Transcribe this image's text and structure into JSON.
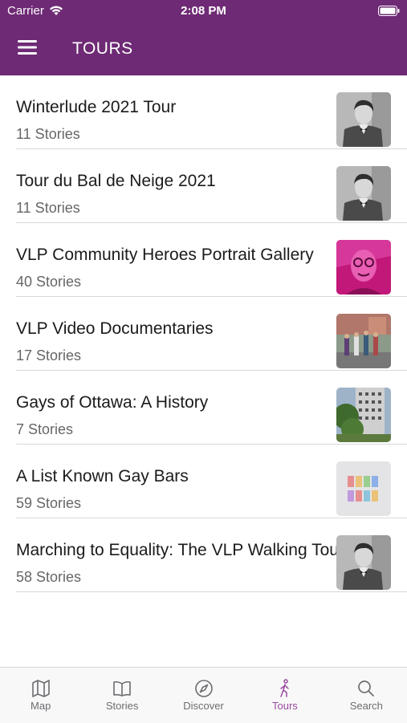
{
  "status_bar": {
    "carrier": "Carrier",
    "time": "2:08 PM"
  },
  "header": {
    "title": "TOURS"
  },
  "tours": [
    {
      "title": "Winterlude 2021 Tour",
      "subtitle": "11 Stories",
      "thumb": "portrait-bw"
    },
    {
      "title": "Tour du Bal de Neige 2021",
      "subtitle": "11 Stories",
      "thumb": "portrait-bw"
    },
    {
      "title": "VLP Community Heroes Portrait Gallery",
      "subtitle": "40 Stories",
      "thumb": "portrait-magenta"
    },
    {
      "title": "VLP Video Documentaries",
      "subtitle": "17 Stories",
      "thumb": "street-people"
    },
    {
      "title": "Gays of Ottawa: A History",
      "subtitle": "7 Stories",
      "thumb": "building"
    },
    {
      "title": "A List Known Gay Bars",
      "subtitle": "59 Stories",
      "thumb": "rainbow-logo"
    },
    {
      "title": "Marching to Equality: The VLP Walking Tour",
      "subtitle": "58 Stories",
      "thumb": "portrait-bw"
    }
  ],
  "tabs": [
    {
      "label": "Map",
      "icon": "map-icon"
    },
    {
      "label": "Stories",
      "icon": "book-icon"
    },
    {
      "label": "Discover",
      "icon": "compass-icon"
    },
    {
      "label": "Tours",
      "icon": "walking-icon",
      "active": true
    },
    {
      "label": "Search",
      "icon": "search-icon"
    }
  ],
  "colors": {
    "header": "#6e2a74",
    "active_tab": "#9a4aa0"
  }
}
